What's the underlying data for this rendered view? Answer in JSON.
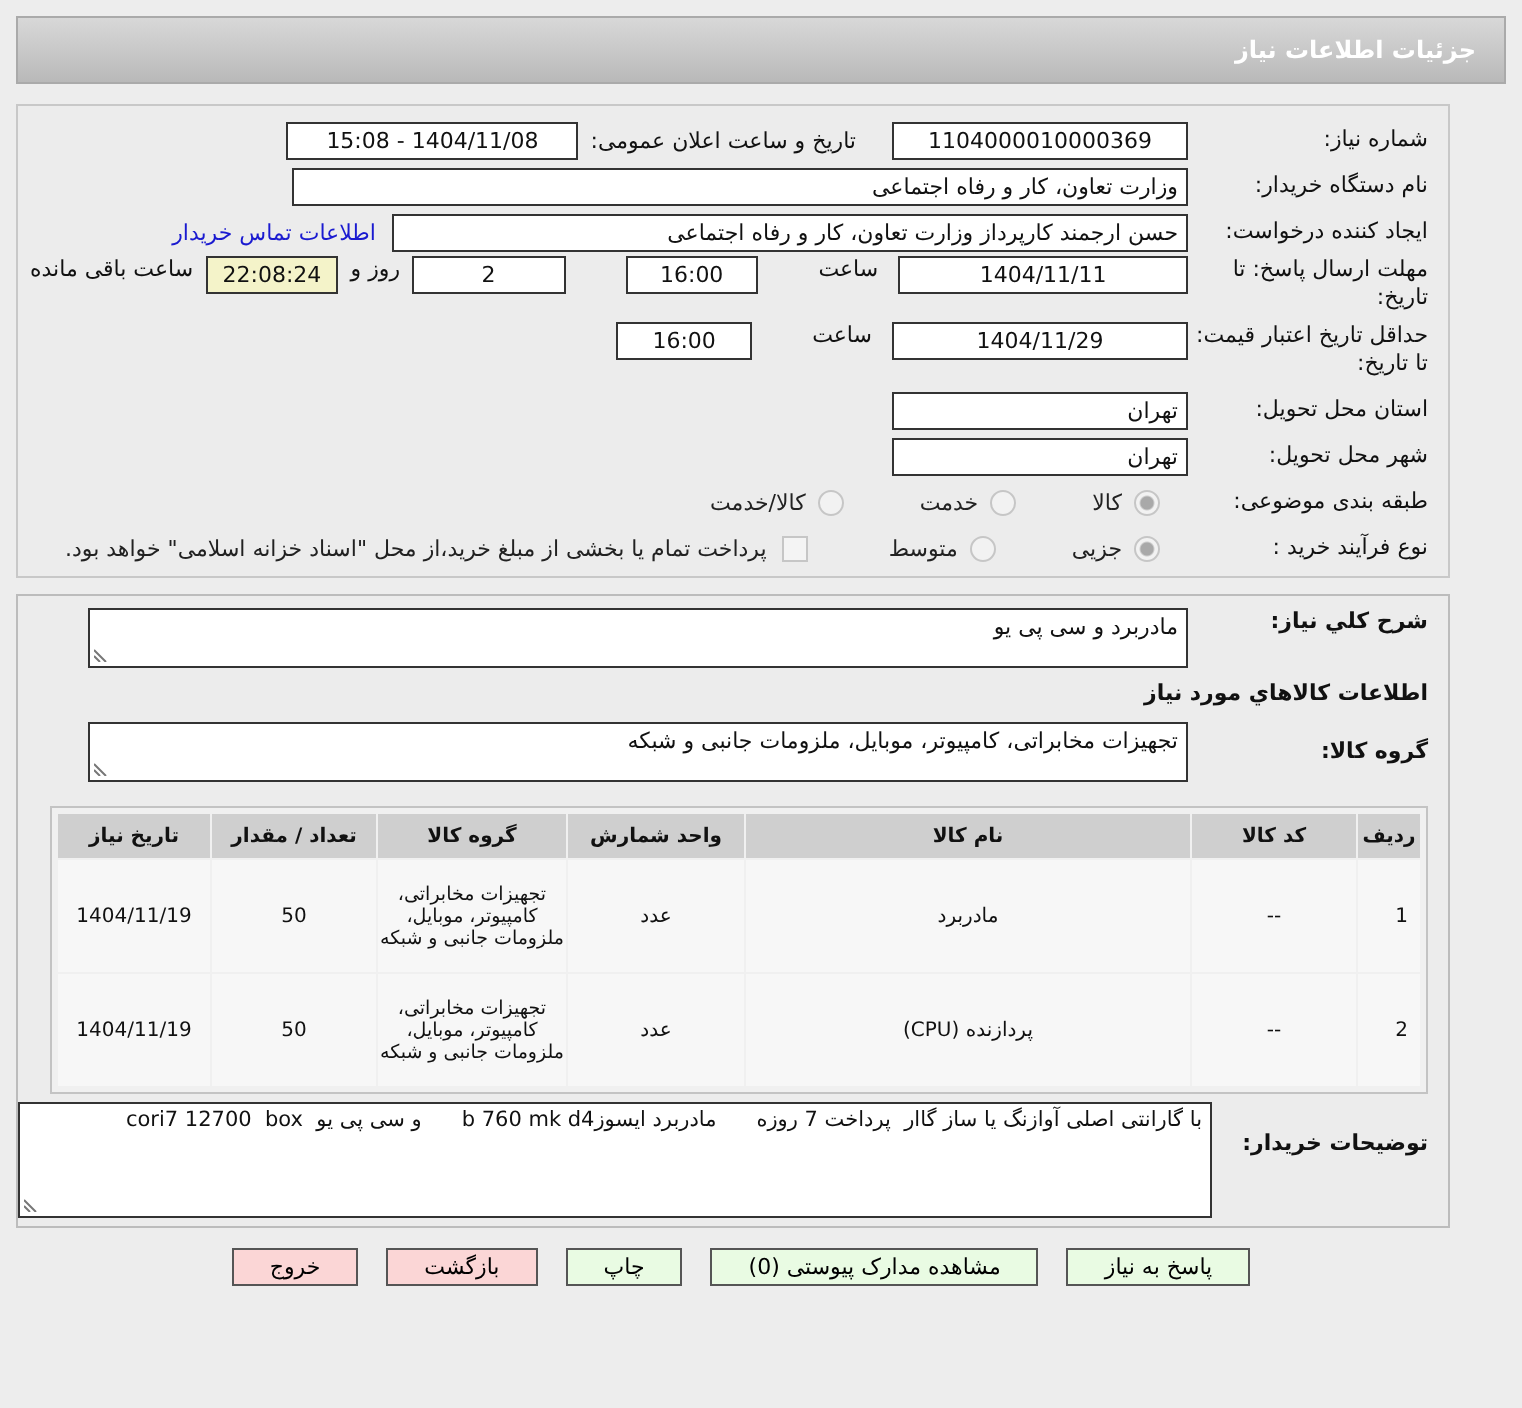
{
  "header": {
    "title": "جزئیات اطلاعات نیاز"
  },
  "need_number": {
    "label": "شماره نیاز:",
    "value": "1104000010000369"
  },
  "announce": {
    "label": "تاریخ و ساعت اعلان عمومی:",
    "value": "1404/11/08 - 15:08"
  },
  "buyer_org": {
    "label": "نام دستگاه خریدار:",
    "value": "وزارت تعاون، کار و رفاه اجتماعی"
  },
  "requester": {
    "label": "ایجاد کننده درخواست:",
    "value": "حسن ارجمند کارپرداز وزارت تعاون، کار و رفاه اجتماعی",
    "link": "اطلاعات تماس خریدار"
  },
  "deadline": {
    "label": "مهلت ارسال پاسخ: تا تاریخ:",
    "date": "1404/11/11",
    "time_label": "ساعت",
    "time": "16:00",
    "days": "2",
    "days_label": "روز و",
    "remaining": "22:08:24",
    "remaining_label": "ساعت باقی مانده"
  },
  "validity": {
    "label": "حداقل تاریخ اعتبار قیمت: تا تاریخ:",
    "date": "1404/11/29",
    "time_label": "ساعت",
    "time": "16:00"
  },
  "province": {
    "label": "استان محل تحویل:",
    "value": "تهران"
  },
  "city": {
    "label": "شهر محل تحویل:",
    "value": "تهران"
  },
  "category": {
    "label": "طبقه بندی موضوعی:",
    "options": [
      {
        "label": "کالا",
        "selected": true
      },
      {
        "label": "خدمت",
        "selected": false
      },
      {
        "label": "کالا/خدمت",
        "selected": false
      }
    ]
  },
  "process": {
    "label": "نوع فرآیند خرید :",
    "options": [
      {
        "label": "جزیی",
        "selected": true
      },
      {
        "label": "متوسط",
        "selected": false
      }
    ],
    "checkbox": {
      "checked": false,
      "label": "پرداخت تمام یا بخشی از مبلغ خرید،از محل \"اسناد خزانه اسلامی\" خواهد بود."
    }
  },
  "summary": {
    "label": "شرح کلي نياز:",
    "value": "مادربرد و سی پی یو"
  },
  "goods_title": "اطلاعات كالاهاي مورد نياز",
  "goods_group": {
    "label": "گروه کالا:",
    "value": "تجهیزات مخابراتی، کامپیوتر، موبایل، ملزومات جانبی و شبکه"
  },
  "table": {
    "columns": [
      "ردیف",
      "کد کالا",
      "نام کالا",
      "واحد شمارش",
      "گروه کالا",
      "تعداد / مقدار",
      "تاریخ نیاز"
    ],
    "rows": [
      {
        "cells": [
          "1",
          "--",
          "مادربرد",
          "عدد",
          "تجهیزات مخابراتی، کامپیوتر، موبایل، ملزومات جانبی و شبکه",
          "50",
          "1404/11/19"
        ]
      },
      {
        "cells": [
          "2",
          "--",
          "پردازنده (CPU)",
          "عدد",
          "تجهیزات مخابراتی، کامپیوتر، موبایل، ملزومات جانبی و شبکه",
          "50",
          "1404/11/19"
        ]
      }
    ]
  },
  "buyer_notes": {
    "label": "توضیحات خریدار:",
    "value": "با گارانتی اصلی آوازنگ یا ساز گاار  پرداخت 7 روزه      مادربرد ایسوزb 760 mk d4      و سی پی یو  cori7 12700  box"
  },
  "buttons": [
    {
      "label": "پاسخ به نیاز",
      "kind": "action"
    },
    {
      "label": "مشاهده مدارک پیوستی (0)",
      "kind": "action"
    },
    {
      "label": "چاپ",
      "kind": "action"
    },
    {
      "label": "بازگشت",
      "kind": "exit"
    },
    {
      "label": "خروج",
      "kind": "exit"
    }
  ]
}
